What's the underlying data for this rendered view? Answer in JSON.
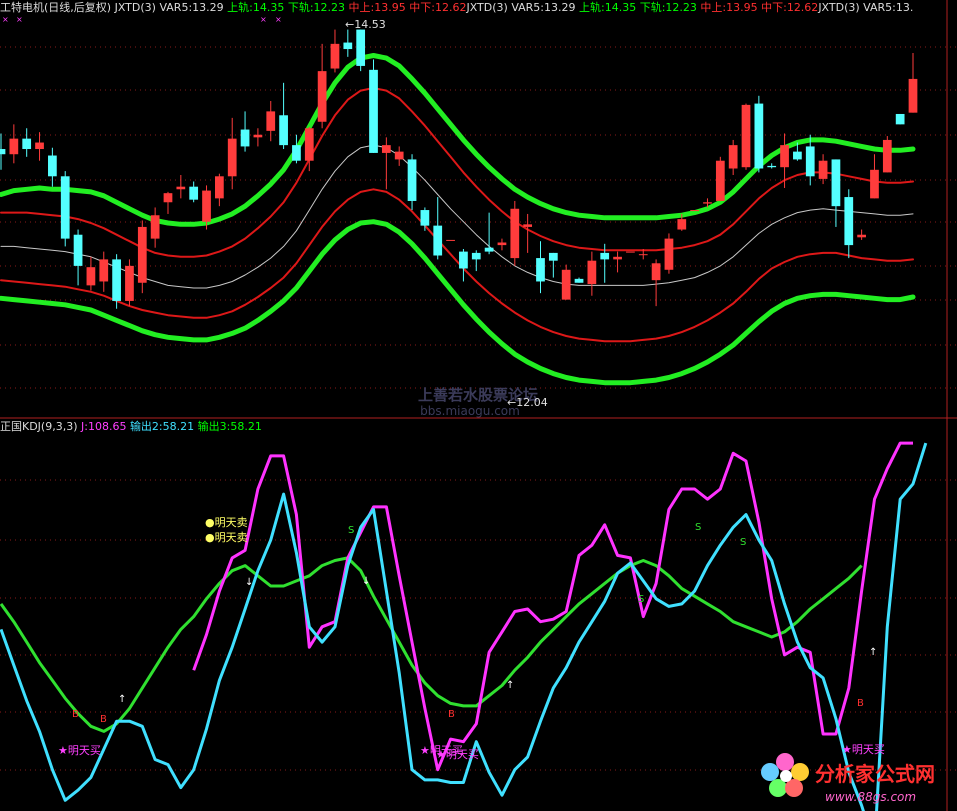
{
  "header_top": [
    {
      "text": "工特电机(日线,后复权)",
      "color": "#dcdcdc"
    },
    {
      "text": " JXTD(3) ",
      "color": "#dcdcdc"
    },
    {
      "text": "VAR5:13.29 ",
      "color": "#dcdcdc"
    },
    {
      "text": "上轨:14.35 ",
      "color": "#00ff00"
    },
    {
      "text": "下轨:12.23 ",
      "color": "#00ff00"
    },
    {
      "text": "中上:13.95 ",
      "color": "#ff3030"
    },
    {
      "text": "中下:12.62",
      "color": "#ff3030"
    },
    {
      "text": "JXTD(3) ",
      "color": "#dcdcdc"
    },
    {
      "text": "VAR5:13.29 ",
      "color": "#dcdcdc"
    },
    {
      "text": "上轨:14.35 ",
      "color": "#00ff00"
    },
    {
      "text": "下轨:12.23 ",
      "color": "#00ff00"
    },
    {
      "text": "中上:13.95 ",
      "color": "#ff3030"
    },
    {
      "text": "中下:12.62",
      "color": "#ff3030"
    },
    {
      "text": "JXTD(3) ",
      "color": "#dcdcdc"
    },
    {
      "text": "VAR5:13.",
      "color": "#dcdcdc"
    }
  ],
  "header_bottom": [
    {
      "text": "正国KDJ(9,3,3) ",
      "color": "#dcdcdc"
    },
    {
      "text": "J:108.65 ",
      "color": "#ff40ff"
    },
    {
      "text": "输出2:58.21 ",
      "color": "#40e0ff"
    },
    {
      "text": "输出3:58.21",
      "color": "#00ff00"
    }
  ],
  "price_labels": {
    "high": "14.53",
    "low": "12.04",
    "high_prefix": "←",
    "low_prefix": "←"
  },
  "watermark": {
    "forum": "上善若水股票论坛",
    "url": "bbs.miaogu.com"
  },
  "logo": {
    "name": "分析家公式网",
    "url": "www.88gs.com"
  },
  "signals": {
    "sell_text": "明天卖",
    "buy_text": "明天买",
    "b_label": "B",
    "s_label": "S",
    "up_arrow": "↑",
    "down_arrow": "↓",
    "star": "★",
    "dot": "●"
  },
  "colors": {
    "background": "#000000",
    "up_candle": "#ff3c3c",
    "down_candle": "#54ffff",
    "outer_band": "#22ee22",
    "inner_band": "#dd1818",
    "middle_line": "#c8c8c8",
    "j_line": "#ff33ff",
    "out2_line": "#40e0ff",
    "out3_line": "#30e030",
    "grid": "#8a1a1a"
  },
  "chart_data": [
    {
      "type": "candlestick",
      "title": "工特电机(日线,后复权)",
      "ylim": [
        11.6,
        14.65
      ],
      "series": [
        {
          "name": "上轨",
          "values": [
            13.26,
            13.29,
            13.3,
            13.31,
            13.3,
            13.3,
            13.29,
            13.28,
            13.25,
            13.2,
            13.15,
            13.1,
            13.06,
            13.04,
            13.03,
            13.03,
            13.04,
            13.07,
            13.11,
            13.17,
            13.25,
            13.34,
            13.45,
            13.6,
            13.78,
            13.96,
            14.12,
            14.24,
            14.31,
            14.33,
            14.31,
            14.25,
            14.15,
            14.04,
            13.92,
            13.8,
            13.68,
            13.57,
            13.47,
            13.38,
            13.3,
            13.24,
            13.19,
            13.15,
            13.12,
            13.1,
            13.09,
            13.08,
            13.08,
            13.08,
            13.08,
            13.08,
            13.09,
            13.1,
            13.12,
            13.15,
            13.2,
            13.28,
            13.38,
            13.48,
            13.56,
            13.62,
            13.66,
            13.68,
            13.68,
            13.67,
            13.65,
            13.63,
            13.61,
            13.6,
            13.6,
            13.61
          ]
        },
        {
          "name": "中上",
          "values": [
            13.12,
            13.12,
            13.12,
            13.11,
            13.1,
            13.09,
            13.07,
            13.04,
            13,
            12.95,
            12.9,
            12.85,
            12.81,
            12.79,
            12.78,
            12.78,
            12.79,
            12.82,
            12.86,
            12.92,
            13,
            13.09,
            13.2,
            13.35,
            13.53,
            13.71,
            13.87,
            13.99,
            14.06,
            14.08,
            14.06,
            14,
            13.9,
            13.79,
            13.67,
            13.55,
            13.43,
            13.32,
            13.22,
            13.13,
            13.05,
            12.99,
            12.94,
            12.9,
            12.87,
            12.85,
            12.84,
            12.83,
            12.83,
            12.83,
            12.83,
            12.83,
            12.84,
            12.85,
            12.87,
            12.9,
            12.95,
            13.03,
            13.13,
            13.23,
            13.31,
            13.37,
            13.41,
            13.43,
            13.43,
            13.42,
            13.4,
            13.38,
            13.36,
            13.35,
            13.35,
            13.36
          ]
        },
        {
          "name": "VAR5",
          "values": [
            12.86,
            12.86,
            12.85,
            12.84,
            12.83,
            12.82,
            12.8,
            12.78,
            12.74,
            12.7,
            12.66,
            12.62,
            12.59,
            12.56,
            12.55,
            12.54,
            12.54,
            12.56,
            12.59,
            12.64,
            12.7,
            12.77,
            12.86,
            12.98,
            13.14,
            13.3,
            13.44,
            13.55,
            13.62,
            13.64,
            13.62,
            13.56,
            13.47,
            13.37,
            13.26,
            13.15,
            13.05,
            12.95,
            12.86,
            12.78,
            12.71,
            12.66,
            12.62,
            12.59,
            12.57,
            12.56,
            12.56,
            12.56,
            12.56,
            12.56,
            12.56,
            12.57,
            12.58,
            12.6,
            12.62,
            12.66,
            12.71,
            12.78,
            12.87,
            12.96,
            13.03,
            13.08,
            13.12,
            13.14,
            13.15,
            13.14,
            13.13,
            13.12,
            13.11,
            13.1,
            13.1,
            13.11
          ]
        },
        {
          "name": "中下",
          "values": [
            12.6,
            12.59,
            12.58,
            12.57,
            12.56,
            12.55,
            12.53,
            12.51,
            12.48,
            12.44,
            12.4,
            12.37,
            12.35,
            12.33,
            12.32,
            12.31,
            12.31,
            12.33,
            12.36,
            12.41,
            12.47,
            12.54,
            12.62,
            12.73,
            12.87,
            13.01,
            13.13,
            13.22,
            13.28,
            13.3,
            13.28,
            13.22,
            13.13,
            13.02,
            12.91,
            12.8,
            12.69,
            12.59,
            12.5,
            12.42,
            12.35,
            12.29,
            12.24,
            12.2,
            12.17,
            12.15,
            12.14,
            12.13,
            12.13,
            12.13,
            12.14,
            12.15,
            12.17,
            12.2,
            12.24,
            12.29,
            12.35,
            12.42,
            12.51,
            12.61,
            12.69,
            12.74,
            12.78,
            12.8,
            12.81,
            12.81,
            12.79,
            12.77,
            12.76,
            12.75,
            12.75,
            12.76
          ]
        },
        {
          "name": "下轨",
          "values": [
            12.46,
            12.45,
            12.44,
            12.43,
            12.42,
            12.41,
            12.39,
            12.37,
            12.33,
            12.29,
            12.25,
            12.21,
            12.18,
            12.16,
            12.15,
            12.14,
            12.14,
            12.16,
            12.19,
            12.23,
            12.29,
            12.36,
            12.44,
            12.54,
            12.67,
            12.8,
            12.91,
            12.99,
            13.04,
            13.05,
            13.03,
            12.97,
            12.88,
            12.77,
            12.65,
            12.53,
            12.41,
            12.3,
            12.2,
            12.11,
            12.03,
            11.97,
            11.92,
            11.88,
            11.85,
            11.83,
            11.82,
            11.81,
            11.81,
            11.81,
            11.82,
            11.83,
            11.85,
            11.88,
            11.92,
            11.97,
            12.03,
            12.1,
            12.19,
            12.28,
            12.36,
            12.42,
            12.46,
            12.48,
            12.49,
            12.49,
            12.48,
            12.47,
            12.46,
            12.45,
            12.45,
            12.47
          ]
        }
      ],
      "candles": [
        [
          13.61,
          13.57,
          13.73,
          13.45
        ],
        [
          13.57,
          13.69,
          13.8,
          13.5
        ],
        [
          13.69,
          13.61,
          13.77,
          13.55
        ],
        [
          13.61,
          13.66,
          13.74,
          13.52
        ],
        [
          13.56,
          13.4,
          13.62,
          13.32
        ],
        [
          13.4,
          12.92,
          13.44,
          12.86
        ],
        [
          12.95,
          12.71,
          12.99,
          12.56
        ],
        [
          12.56,
          12.7,
          12.78,
          12.52
        ],
        [
          12.59,
          12.76,
          12.82,
          12.51
        ],
        [
          12.76,
          12.44,
          12.8,
          12.38
        ],
        [
          12.44,
          12.71,
          12.76,
          12.4
        ],
        [
          12.58,
          13.01,
          13.06,
          12.5
        ],
        [
          12.92,
          13.1,
          13.16,
          12.85
        ],
        [
          13.2,
          13.27,
          13.28,
          13.11
        ],
        [
          13.3,
          13.32,
          13.41,
          13.23
        ],
        [
          13.32,
          13.22,
          13.36,
          13.2
        ],
        [
          13.05,
          13.29,
          13.33,
          12.99
        ],
        [
          13.23,
          13.4,
          13.42,
          13.17
        ],
        [
          13.4,
          13.69,
          13.85,
          13.3
        ],
        [
          13.76,
          13.63,
          13.9,
          13.59
        ],
        [
          13.7,
          13.72,
          13.77,
          13.63
        ],
        [
          13.75,
          13.9,
          13.98,
          13.67
        ],
        [
          13.87,
          13.64,
          14.12,
          13.61
        ],
        [
          13.64,
          13.52,
          13.72,
          13.5
        ],
        [
          13.52,
          13.77,
          13.78,
          13.44
        ],
        [
          13.82,
          14.21,
          14.42,
          13.77
        ],
        [
          14.23,
          14.42,
          14.53,
          14.2
        ],
        [
          14.43,
          14.38,
          14.53,
          14.32
        ],
        [
          14.53,
          14.25,
          14.53,
          14.21
        ],
        [
          14.22,
          13.58,
          14.3,
          13.58
        ],
        [
          13.58,
          13.64,
          13.7,
          13.3
        ],
        [
          13.53,
          13.59,
          13.63,
          13.48
        ],
        [
          13.53,
          13.21,
          13.57,
          13.14
        ],
        [
          13.14,
          13.02,
          13.16,
          12.98
        ],
        [
          13.02,
          12.79,
          13.24,
          12.76
        ],
        [
          12.91,
          12.91,
          12.91,
          12.91
        ],
        [
          12.82,
          12.69,
          12.84,
          12.59
        ],
        [
          12.81,
          12.76,
          12.83,
          12.67
        ],
        [
          12.85,
          12.82,
          13.12,
          12.8
        ],
        [
          12.87,
          12.89,
          12.92,
          12.83
        ],
        [
          12.77,
          13.15,
          13.21,
          12.71
        ],
        [
          13.01,
          13.03,
          13.11,
          12.81
        ],
        [
          12.77,
          12.59,
          12.9,
          12.5
        ],
        [
          12.81,
          12.75,
          12.81,
          12.62
        ],
        [
          12.45,
          12.68,
          12.72,
          12.5
        ],
        [
          12.61,
          12.58,
          12.62,
          12.58
        ],
        [
          12.57,
          12.75,
          12.82,
          12.48
        ],
        [
          12.81,
          12.76,
          12.88,
          12.58
        ],
        [
          12.76,
          12.78,
          12.82,
          12.66
        ],
        [
          12.82,
          12.82,
          12.82,
          12.82
        ],
        [
          12.8,
          12.8,
          12.84,
          12.76
        ],
        [
          12.6,
          12.73,
          12.76,
          12.4
        ],
        [
          12.68,
          12.92,
          12.96,
          12.65
        ],
        [
          12.99,
          13.07,
          13.11,
          12.98
        ],
        [
          13.14,
          13.14,
          13.14,
          13.14
        ],
        [
          13.19,
          13.2,
          13.23,
          13.16
        ],
        [
          13.21,
          13.52,
          13.55,
          13.23
        ],
        [
          13.46,
          13.64,
          13.68,
          13.41
        ],
        [
          13.47,
          13.95,
          13.96,
          13.45
        ],
        [
          13.96,
          13.46,
          14.02,
          13.43
        ],
        [
          13.48,
          13.47,
          13.5,
          13.46
        ],
        [
          13.47,
          13.64,
          13.73,
          13.31
        ],
        [
          13.59,
          13.53,
          13.66,
          13.52
        ],
        [
          13.63,
          13.4,
          13.72,
          13.33
        ],
        [
          13.38,
          13.52,
          13.57,
          13.34
        ],
        [
          13.53,
          13.17,
          13.53,
          13.01
        ],
        [
          13.24,
          12.87,
          13.3,
          12.77
        ],
        [
          12.93,
          12.95,
          12.99,
          12.91
        ],
        [
          13.23,
          13.45,
          13.57,
          13.24
        ],
        [
          13.43,
          13.68,
          13.71,
          13.64
        ],
        [
          13.88,
          13.8,
          13.87,
          13.91
        ],
        [
          13.89,
          14.15,
          14.35,
          13.9
        ]
      ],
      "annotations": [
        "14.53",
        "12.04"
      ]
    },
    {
      "type": "line",
      "title": "正国KDJ(9,3,3)",
      "ylim": [
        -25,
        120
      ],
      "series": [
        {
          "name": "J",
          "values": [
            null,
            null,
            null,
            null,
            null,
            null,
            null,
            null,
            null,
            null,
            null,
            null,
            null,
            null,
            null,
            29,
            43,
            60,
            73,
            76,
            100,
            113,
            113,
            90,
            38,
            46,
            48,
            73,
            83,
            93,
            93,
            66,
            40,
            14,
            -10,
            2,
            1,
            8,
            36,
            44,
            52,
            53,
            48,
            49,
            52,
            74,
            78,
            86,
            74,
            73,
            50,
            63,
            92,
            100,
            100,
            96,
            100,
            114,
            111,
            87,
            57,
            35,
            38,
            36,
            4,
            4,
            22,
            60,
            96,
            108,
            118,
            118
          ]
        },
        {
          "name": "输出2",
          "values": [
            45,
            31,
            17,
            5,
            -10,
            -22,
            -18,
            -13,
            -2,
            9,
            9,
            7,
            -6,
            -8,
            -17,
            -10,
            6,
            25,
            38,
            53,
            68,
            80,
            98,
            75,
            46,
            40,
            46,
            70,
            85,
            92,
            60,
            28,
            -10,
            -14,
            -14,
            -15,
            -15,
            1,
            -11,
            -20,
            -10,
            -5,
            9,
            22,
            30,
            40,
            48,
            56,
            67,
            71,
            64,
            57,
            54,
            55,
            60,
            70,
            78,
            85,
            90,
            80,
            72,
            55,
            40,
            30,
            26,
            10,
            -11,
            -24,
            -40,
            46,
            96,
            102,
            118
          ]
        },
        {
          "name": "输出3",
          "values": [
            55,
            48,
            40,
            32,
            25,
            18,
            12,
            7,
            5,
            8,
            14,
            22,
            30,
            38,
            45,
            50,
            57,
            63,
            68,
            70,
            66,
            62,
            62,
            64,
            66,
            70,
            72,
            73,
            68,
            58,
            49,
            40,
            31,
            24,
            19,
            16,
            15,
            15,
            19,
            23,
            29,
            34,
            40,
            45,
            50,
            55,
            59,
            63,
            67,
            70,
            72,
            70,
            66,
            61,
            58,
            55,
            52,
            48,
            46,
            44,
            42,
            44,
            48,
            53,
            57,
            61,
            65,
            70
          ]
        }
      ]
    }
  ]
}
